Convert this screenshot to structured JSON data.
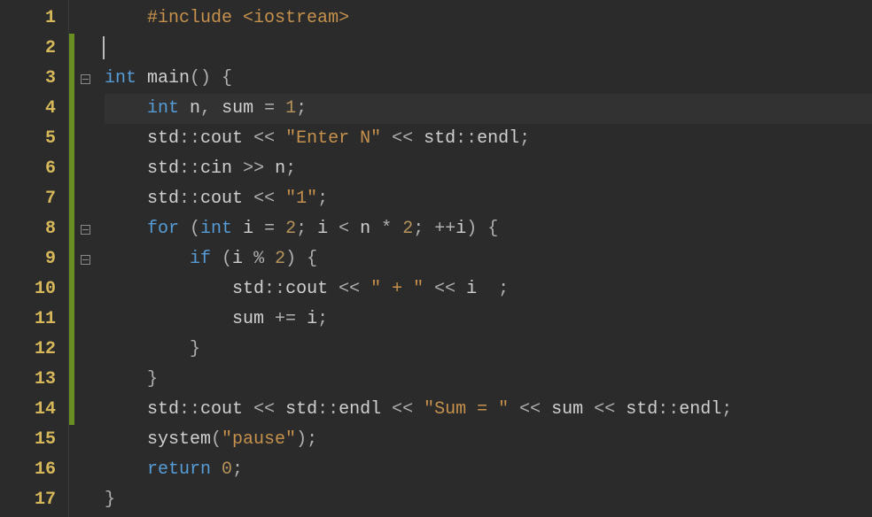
{
  "editor": {
    "highlighted_line": 4,
    "lines": [
      {
        "num": 1,
        "indent": "    ",
        "changed": false,
        "fold": false,
        "tokens": [
          {
            "t": "#include ",
            "c": "tok-preproc"
          },
          {
            "t": "<iostream>",
            "c": "tok-string"
          }
        ]
      },
      {
        "num": 2,
        "indent": "",
        "changed": true,
        "fold": false,
        "cursor": true,
        "tokens": []
      },
      {
        "num": 3,
        "indent": "",
        "changed": true,
        "fold": true,
        "tokens": [
          {
            "t": "int ",
            "c": "tok-type"
          },
          {
            "t": "main",
            "c": "tok-func"
          },
          {
            "t": "() {",
            "c": "tok-punct"
          }
        ]
      },
      {
        "num": 4,
        "indent": "    ",
        "changed": true,
        "fold": false,
        "highlight": true,
        "tokens": [
          {
            "t": "int ",
            "c": "tok-type"
          },
          {
            "t": "n",
            "c": "tok-ident"
          },
          {
            "t": ", ",
            "c": "tok-punct"
          },
          {
            "t": "sum ",
            "c": "tok-ident"
          },
          {
            "t": "= ",
            "c": "tok-op"
          },
          {
            "t": "1",
            "c": "tok-number"
          },
          {
            "t": ";",
            "c": "tok-punct"
          }
        ]
      },
      {
        "num": 5,
        "indent": "    ",
        "changed": true,
        "fold": false,
        "tokens": [
          {
            "t": "std",
            "c": "tok-std"
          },
          {
            "t": "::",
            "c": "tok-punct"
          },
          {
            "t": "cout ",
            "c": "tok-ident"
          },
          {
            "t": "<< ",
            "c": "tok-op"
          },
          {
            "t": "\"Enter N\"",
            "c": "tok-string"
          },
          {
            "t": " << ",
            "c": "tok-op"
          },
          {
            "t": "std",
            "c": "tok-std"
          },
          {
            "t": "::",
            "c": "tok-punct"
          },
          {
            "t": "endl",
            "c": "tok-ident"
          },
          {
            "t": ";",
            "c": "tok-punct"
          }
        ]
      },
      {
        "num": 6,
        "indent": "    ",
        "changed": true,
        "fold": false,
        "tokens": [
          {
            "t": "std",
            "c": "tok-std"
          },
          {
            "t": "::",
            "c": "tok-punct"
          },
          {
            "t": "cin ",
            "c": "tok-ident"
          },
          {
            "t": ">> ",
            "c": "tok-op"
          },
          {
            "t": "n",
            "c": "tok-ident"
          },
          {
            "t": ";",
            "c": "tok-punct"
          }
        ]
      },
      {
        "num": 7,
        "indent": "    ",
        "changed": true,
        "fold": false,
        "tokens": [
          {
            "t": "std",
            "c": "tok-std"
          },
          {
            "t": "::",
            "c": "tok-punct"
          },
          {
            "t": "cout ",
            "c": "tok-ident"
          },
          {
            "t": "<< ",
            "c": "tok-op"
          },
          {
            "t": "\"1\"",
            "c": "tok-string"
          },
          {
            "t": ";",
            "c": "tok-punct"
          }
        ]
      },
      {
        "num": 8,
        "indent": "    ",
        "changed": true,
        "fold": true,
        "tokens": [
          {
            "t": "for ",
            "c": "tok-keyword"
          },
          {
            "t": "(",
            "c": "tok-punct"
          },
          {
            "t": "int ",
            "c": "tok-type"
          },
          {
            "t": "i ",
            "c": "tok-ident"
          },
          {
            "t": "= ",
            "c": "tok-op"
          },
          {
            "t": "2",
            "c": "tok-number"
          },
          {
            "t": "; ",
            "c": "tok-punct"
          },
          {
            "t": "i ",
            "c": "tok-ident"
          },
          {
            "t": "< ",
            "c": "tok-op"
          },
          {
            "t": "n ",
            "c": "tok-ident"
          },
          {
            "t": "* ",
            "c": "tok-op"
          },
          {
            "t": "2",
            "c": "tok-number"
          },
          {
            "t": "; ",
            "c": "tok-punct"
          },
          {
            "t": "++",
            "c": "tok-op"
          },
          {
            "t": "i",
            "c": "tok-ident"
          },
          {
            "t": ") {",
            "c": "tok-punct"
          }
        ]
      },
      {
        "num": 9,
        "indent": "        ",
        "changed": true,
        "fold": true,
        "tokens": [
          {
            "t": "if ",
            "c": "tok-keyword"
          },
          {
            "t": "(",
            "c": "tok-punct"
          },
          {
            "t": "i ",
            "c": "tok-ident"
          },
          {
            "t": "% ",
            "c": "tok-op"
          },
          {
            "t": "2",
            "c": "tok-number"
          },
          {
            "t": ") {",
            "c": "tok-punct"
          }
        ]
      },
      {
        "num": 10,
        "indent": "            ",
        "changed": true,
        "fold": false,
        "tokens": [
          {
            "t": "std",
            "c": "tok-std"
          },
          {
            "t": "::",
            "c": "tok-punct"
          },
          {
            "t": "cout ",
            "c": "tok-ident"
          },
          {
            "t": "<< ",
            "c": "tok-op"
          },
          {
            "t": "\" + \"",
            "c": "tok-string"
          },
          {
            "t": " << ",
            "c": "tok-op"
          },
          {
            "t": "i  ",
            "c": "tok-ident"
          },
          {
            "t": ";",
            "c": "tok-punct"
          }
        ]
      },
      {
        "num": 11,
        "indent": "            ",
        "changed": true,
        "fold": false,
        "tokens": [
          {
            "t": "sum ",
            "c": "tok-ident"
          },
          {
            "t": "+= ",
            "c": "tok-op"
          },
          {
            "t": "i",
            "c": "tok-ident"
          },
          {
            "t": ";",
            "c": "tok-punct"
          }
        ]
      },
      {
        "num": 12,
        "indent": "        ",
        "changed": true,
        "fold": false,
        "tokens": [
          {
            "t": "}",
            "c": "tok-punct"
          }
        ]
      },
      {
        "num": 13,
        "indent": "    ",
        "changed": true,
        "fold": false,
        "tokens": [
          {
            "t": "}",
            "c": "tok-punct"
          }
        ]
      },
      {
        "num": 14,
        "indent": "    ",
        "changed": true,
        "fold": false,
        "tokens": [
          {
            "t": "std",
            "c": "tok-std"
          },
          {
            "t": "::",
            "c": "tok-punct"
          },
          {
            "t": "cout ",
            "c": "tok-ident"
          },
          {
            "t": "<< ",
            "c": "tok-op"
          },
          {
            "t": "std",
            "c": "tok-std"
          },
          {
            "t": "::",
            "c": "tok-punct"
          },
          {
            "t": "endl ",
            "c": "tok-ident"
          },
          {
            "t": "<< ",
            "c": "tok-op"
          },
          {
            "t": "\"Sum = \"",
            "c": "tok-string"
          },
          {
            "t": " << ",
            "c": "tok-op"
          },
          {
            "t": "sum ",
            "c": "tok-ident"
          },
          {
            "t": "<< ",
            "c": "tok-op"
          },
          {
            "t": "std",
            "c": "tok-std"
          },
          {
            "t": "::",
            "c": "tok-punct"
          },
          {
            "t": "endl",
            "c": "tok-ident"
          },
          {
            "t": ";",
            "c": "tok-punct"
          }
        ]
      },
      {
        "num": 15,
        "indent": "    ",
        "changed": false,
        "fold": false,
        "tokens": [
          {
            "t": "system",
            "c": "tok-func"
          },
          {
            "t": "(",
            "c": "tok-punct"
          },
          {
            "t": "\"pause\"",
            "c": "tok-string"
          },
          {
            "t": ");",
            "c": "tok-punct"
          }
        ]
      },
      {
        "num": 16,
        "indent": "    ",
        "changed": false,
        "fold": false,
        "tokens": [
          {
            "t": "return ",
            "c": "tok-keyword"
          },
          {
            "t": "0",
            "c": "tok-number"
          },
          {
            "t": ";",
            "c": "tok-punct"
          }
        ]
      },
      {
        "num": 17,
        "indent": "",
        "changed": false,
        "fold": false,
        "tokens": [
          {
            "t": "}",
            "c": "tok-punct"
          }
        ]
      }
    ]
  }
}
